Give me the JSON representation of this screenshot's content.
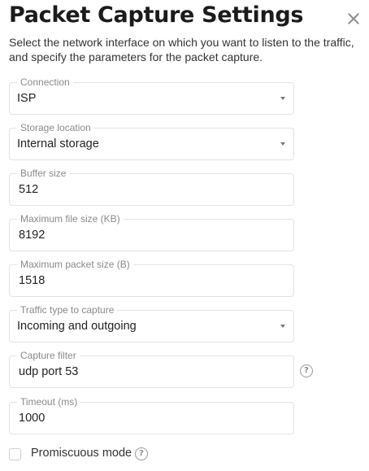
{
  "dialog": {
    "title": "Packet Capture Settings",
    "description": "Select the network interface on which you want to listen to the traffic, and specify the parameters for the packet capture.",
    "close_icon": "close-icon"
  },
  "fields": {
    "connection": {
      "label": "Connection",
      "value": "ISP"
    },
    "storage_location": {
      "label": "Storage location",
      "value": "Internal storage"
    },
    "buffer_size": {
      "label": "Buffer size",
      "value": "512"
    },
    "max_file_size": {
      "label": "Maximum file size (KB)",
      "value": "8192"
    },
    "max_packet_size": {
      "label": "Maximum packet size (B)",
      "value": "1518"
    },
    "traffic_type": {
      "label": "Traffic type to capture",
      "value": "Incoming and outgoing"
    },
    "capture_filter": {
      "label": "Capture filter",
      "value": "udp port 53"
    },
    "timeout": {
      "label": "Timeout (ms)",
      "value": "1000"
    }
  },
  "promiscuous": {
    "label": "Promiscuous mode",
    "checked": false
  },
  "help_icon": {
    "glyph": "?"
  }
}
